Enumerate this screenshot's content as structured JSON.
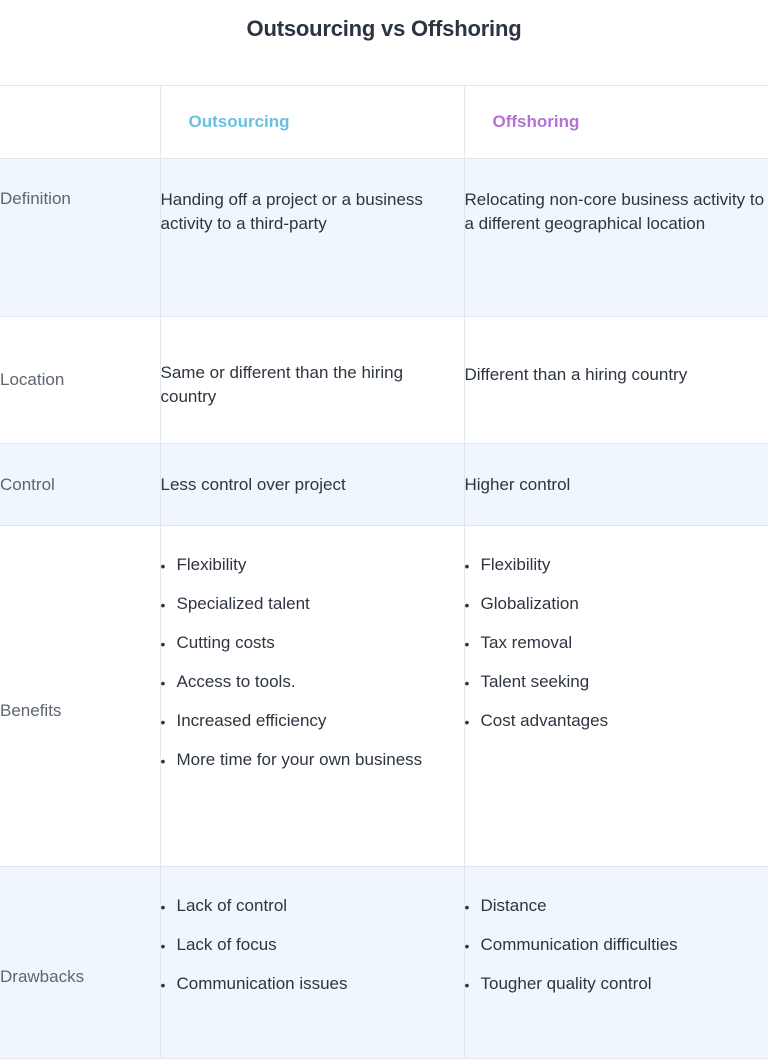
{
  "title": "Outsourcing vs Offshoring",
  "colors": {
    "outsourcing": "#6cbfe0",
    "offshoring": "#b472d2",
    "row_shade": "#f0f6fd",
    "border": "#e3e7ec"
  },
  "table": {
    "headers": [
      "",
      "Outsourcing",
      "Offshoring"
    ],
    "rows": [
      {
        "label": "Definition",
        "outsourcing": "Handing off a project or a business activity to a third-party",
        "offshoring": "Relocating non-core business activity to a different geographical location"
      },
      {
        "label": "Location",
        "outsourcing": "Same or different than the hiring country",
        "offshoring": "Different than a hiring country"
      },
      {
        "label": "Control",
        "outsourcing": "Less control over project",
        "offshoring": "Higher control"
      },
      {
        "label": "Benefits",
        "outsourcing": [
          "Flexibility",
          "Specialized talent",
          "Cutting costs",
          "Access to tools.",
          "Increased efficiency",
          "More time for your own business"
        ],
        "offshoring": [
          "Flexibility",
          "Globalization",
          "Tax removal",
          "Talent seeking",
          "Cost advantages"
        ]
      },
      {
        "label": "Drawbacks",
        "outsourcing": [
          "Lack of control",
          "Lack of focus",
          "Communication issues"
        ],
        "offshoring": [
          "Distance",
          "Communication difficulties",
          "Tougher quality control"
        ]
      }
    ]
  },
  "bullet_glyph": "•"
}
